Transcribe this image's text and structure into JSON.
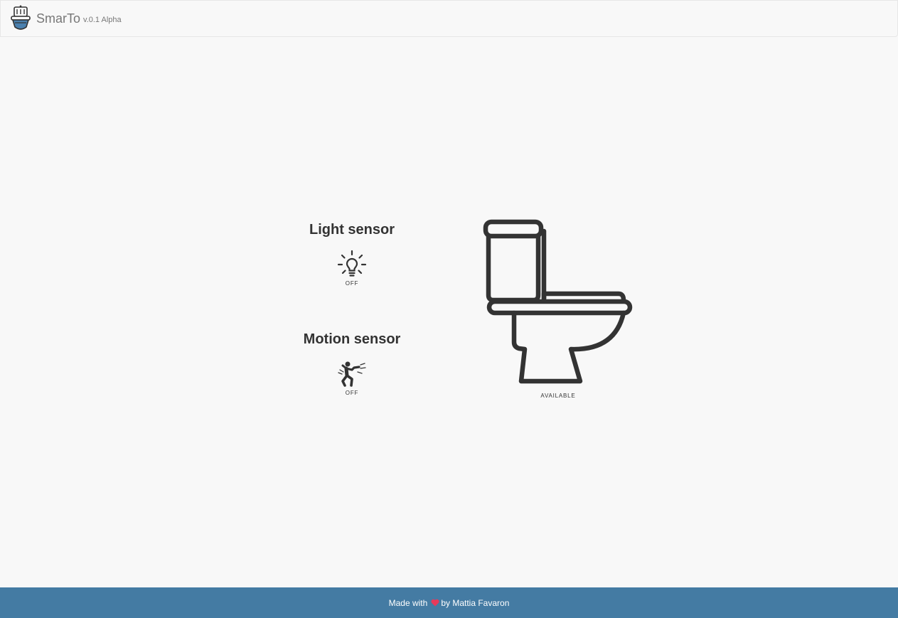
{
  "navbar": {
    "brand_name": "SmarTo",
    "version": "v.0.1 Alpha",
    "logo_icon": "toilet-logo-icon"
  },
  "light_sensor": {
    "title": "Light sensor",
    "icon": "lightbulb-icon",
    "status": "OFF"
  },
  "motion_sensor": {
    "title": "Motion sensor",
    "icon": "running-person-icon",
    "status": "OFF"
  },
  "toilet": {
    "icon": "toilet-icon",
    "status": "AVAILABLE"
  },
  "footer": {
    "made_with": "Made with",
    "heart_icon": "heart-icon",
    "by": "by Mattia Favaron",
    "heart_color": "#e8395a",
    "background_color": "#447ba3"
  }
}
